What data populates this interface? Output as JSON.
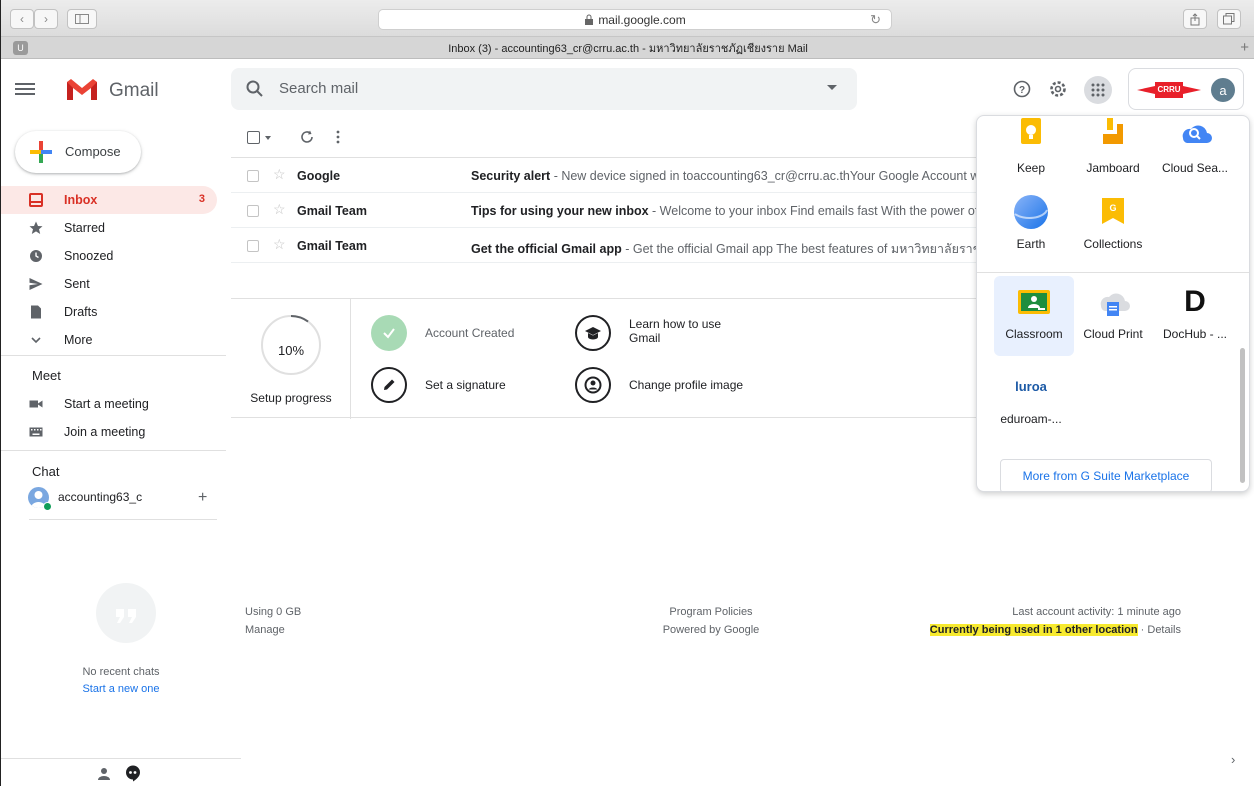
{
  "browser": {
    "url": "mail.google.com",
    "tab_title": "Inbox (3) - accounting63_cr@crru.ac.th - มหาวิทยาลัยราชภัฏเชียงราย Mail",
    "tab_favicon": "U"
  },
  "header": {
    "logo_text": "Gmail",
    "search_placeholder": "Search mail"
  },
  "sidebar": {
    "compose_label": "Compose",
    "items": [
      {
        "label": "Inbox",
        "icon": "inbox-icon",
        "count": "3"
      },
      {
        "label": "Starred",
        "icon": "star-icon"
      },
      {
        "label": "Snoozed",
        "icon": "clock-icon"
      },
      {
        "label": "Sent",
        "icon": "send-icon"
      },
      {
        "label": "Drafts",
        "icon": "draft-icon"
      },
      {
        "label": "More",
        "icon": "chevron-down-icon"
      }
    ],
    "meet_title": "Meet",
    "meet_items": [
      {
        "label": "Start a meeting",
        "icon": "video-icon"
      },
      {
        "label": "Join a meeting",
        "icon": "keyboard-icon"
      }
    ],
    "chat_title": "Chat",
    "chat_user": "accounting63_c",
    "no_chats": "No recent chats",
    "start_new": "Start a new one"
  },
  "emails": [
    {
      "sender": "Google",
      "subject": "Security alert",
      "snippet": " - New device signed in toaccounting63_cr@crru.ac.thYour Google Account was just signed in to from a new device"
    },
    {
      "sender": "Gmail Team",
      "subject": "Tips for using your new inbox",
      "snippet": " - Welcome to your inbox Find emails fast With the power of Google Search in your inbox"
    },
    {
      "sender": "Gmail Team",
      "subject": "Get the official Gmail app",
      "snippet": " - Get the official Gmail app The best features of มหาวิทยาลัยราชภัฏเชียงราย Mail"
    }
  ],
  "setup": {
    "progress": 10,
    "progress_text": "10%",
    "label": "Setup progress",
    "tasks": [
      {
        "label": "Account Created",
        "done": true
      },
      {
        "label": "Learn how to use\nGmail"
      },
      {
        "label": "Set a signature"
      },
      {
        "label": "Change profile image"
      }
    ]
  },
  "footer": {
    "storage": "Using 0 GB",
    "manage": "Manage",
    "policies": "Program Policies",
    "powered": "Powered by Google",
    "last_activity": "Last account activity: 1 minute ago",
    "other_location": "Currently being used in 1 other location",
    "details": " · Details"
  },
  "apps_panel": {
    "apps": [
      {
        "label": "Keep",
        "icon": "keep-icon"
      },
      {
        "label": "Jamboard",
        "icon": "jamboard-icon"
      },
      {
        "label": "Cloud Sea...",
        "icon": "cloud-search-icon"
      },
      {
        "label": "Earth",
        "icon": "earth-icon"
      },
      {
        "label": "Collections",
        "icon": "collections-icon"
      },
      {
        "label": "Classroom",
        "icon": "classroom-icon"
      },
      {
        "label": "Cloud Print",
        "icon": "cloud-print-icon"
      },
      {
        "label": "DocHub - ...",
        "icon": "dochub-icon"
      },
      {
        "label": "eduroam-...",
        "icon": "eduroam-icon"
      }
    ],
    "more_label": "More from G Suite Marketplace",
    "eduroam_mark": "luroa",
    "dochub_mark": "D"
  },
  "account": {
    "avatar_letter": "a",
    "org_logo": "CRRU"
  },
  "colors": {
    "accent_red": "#d93025",
    "link_blue": "#1a73e8",
    "highlight_yellow": "#f7ea2f"
  }
}
